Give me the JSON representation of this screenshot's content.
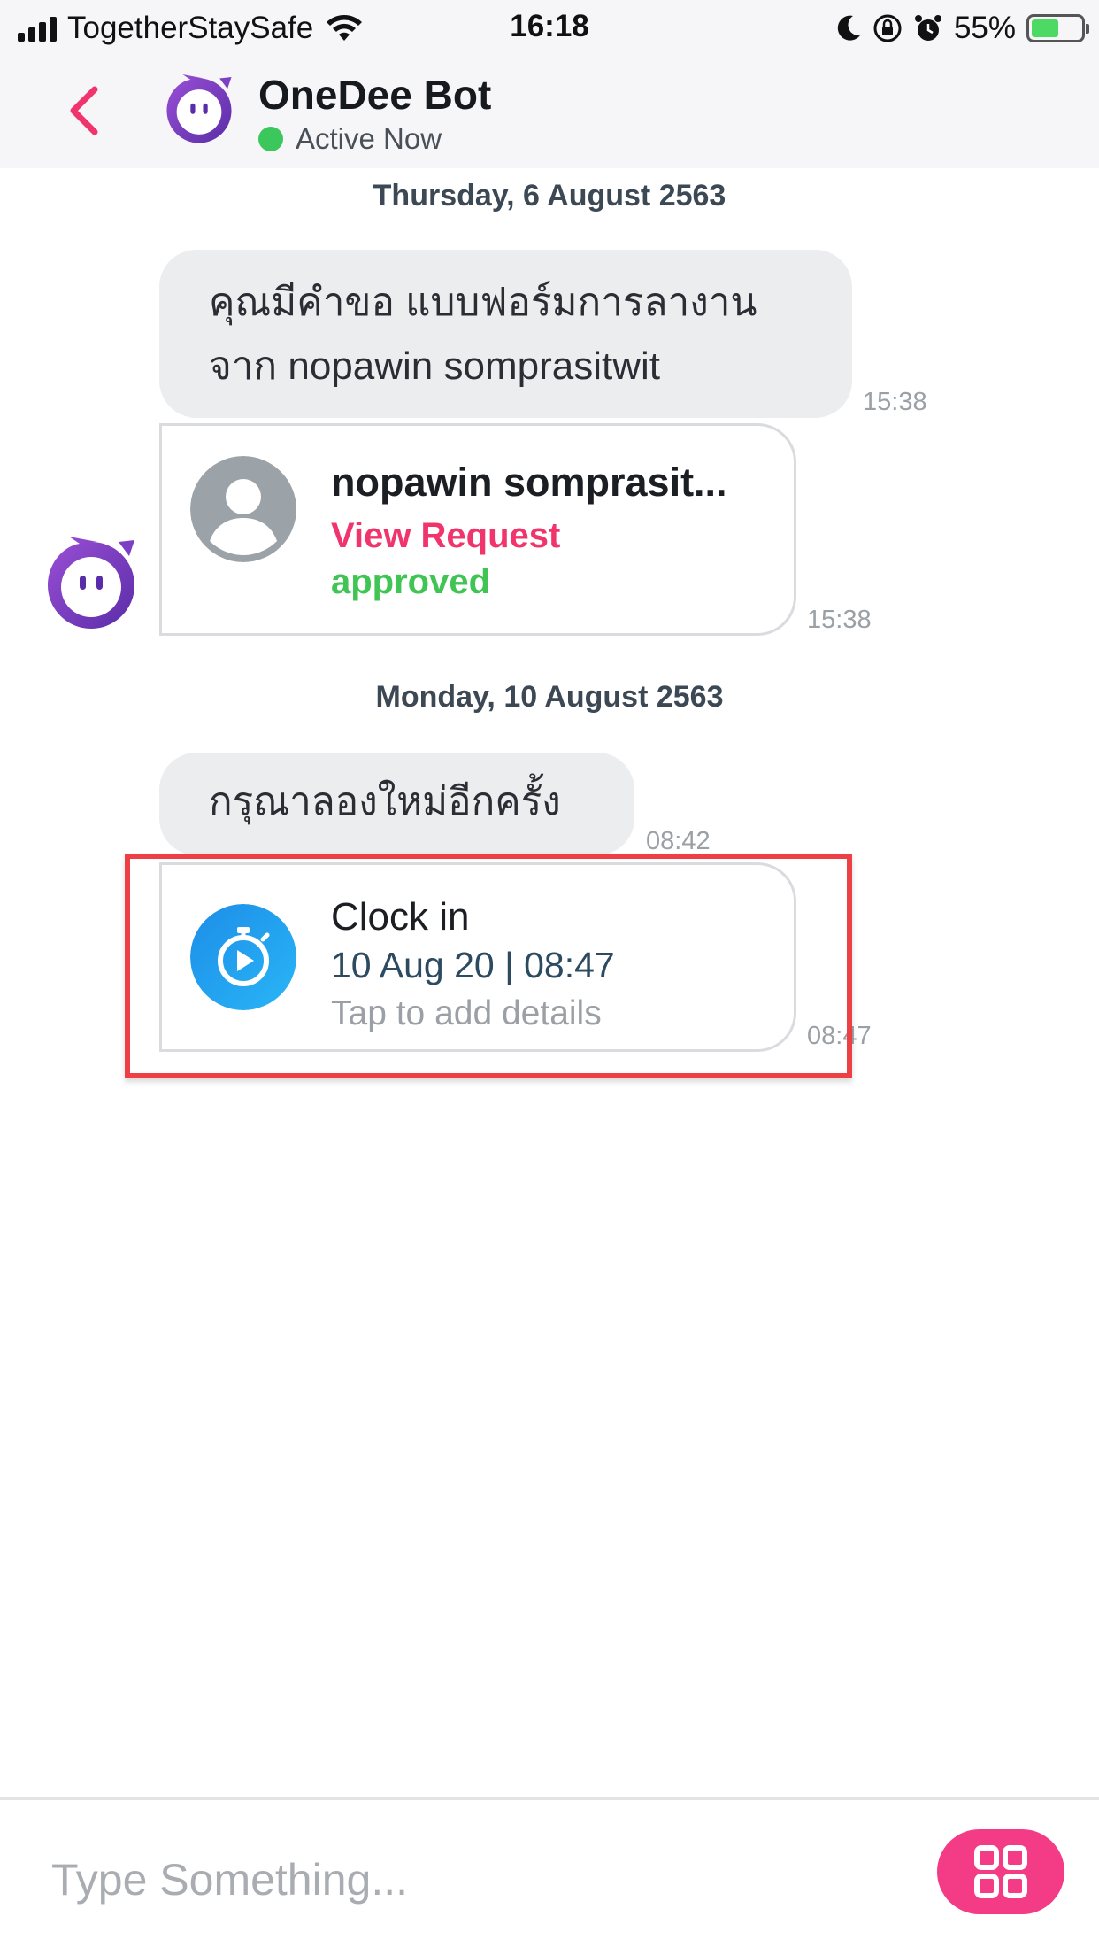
{
  "status_bar": {
    "carrier": "TogetherStaySafe",
    "time": "16:18",
    "battery_percent": "55%",
    "battery_level": 0.55,
    "icons": [
      "signal-icon",
      "wifi-icon",
      "moon-icon",
      "rotation-lock-icon",
      "alarm-icon",
      "battery-icon"
    ]
  },
  "header": {
    "title": "OneDee Bot",
    "status": "Active Now",
    "back_icon": "chevron-left-icon",
    "avatar_icon": "bot-face-icon",
    "colors": {
      "accent": "#f0356d",
      "online": "#3cc75d",
      "bot_purple": "#7b3fc4"
    }
  },
  "messages": [
    {
      "date": "Thursday, 6 August 2563"
    },
    {
      "type": "text",
      "lines": [
        "คุณมีคำขอ แบบฟอร์มการลางาน",
        "จาก nopawin somprasitwit"
      ],
      "time": "15:38"
    },
    {
      "type": "request_card",
      "name": "nopawin somprasit...",
      "link": "View Request",
      "status": "approved",
      "time": "15:38"
    },
    {
      "date": "Monday, 10 August 2563"
    },
    {
      "type": "text",
      "lines": [
        "กรุณาลองใหม่อีกครั้ง"
      ],
      "time": "08:42"
    },
    {
      "type": "clock_card",
      "title": "Clock in",
      "datetime": "10 Aug 20 | 08:47",
      "hint": "Tap to add details",
      "time": "08:47",
      "accent": "#1e9af0"
    }
  ],
  "input": {
    "placeholder": "Type Something...",
    "menu_icon": "grid-icon",
    "menu_color": "#f43b86"
  }
}
